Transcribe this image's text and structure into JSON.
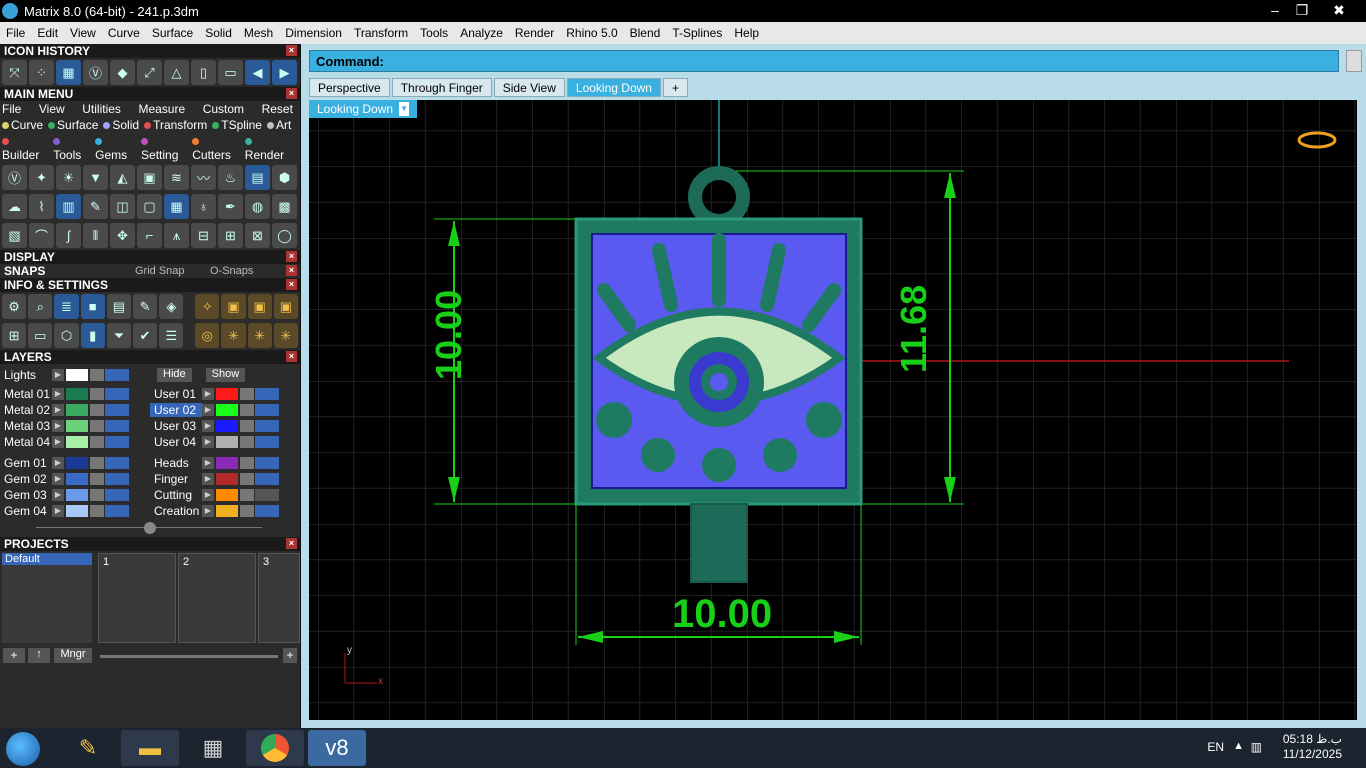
{
  "window": {
    "title": "Matrix 8.0 (64-bit) - 241.p.3dm",
    "controls": {
      "minimize": "‒",
      "maximize": "❐",
      "close": "✖"
    }
  },
  "menubar": [
    "File",
    "Edit",
    "View",
    "Curve",
    "Surface",
    "Solid",
    "Mesh",
    "Dimension",
    "Transform",
    "Tools",
    "Analyze",
    "Render",
    "Rhino 5.0",
    "Blend",
    "T-Splines",
    "Help"
  ],
  "panels": {
    "icon_history": "ICON HISTORY",
    "main_menu": "MAIN MENU",
    "main_menu_row1": [
      "File",
      "View",
      "Utilities",
      "Measure",
      "Custom",
      "Reset"
    ],
    "main_menu_row2": [
      {
        "label": "Curve",
        "color": "#d8d860"
      },
      {
        "label": "Surface",
        "color": "#3ab060"
      },
      {
        "label": "Solid",
        "color": "#a0a0ff"
      },
      {
        "label": "Transform",
        "color": "#e05050"
      },
      {
        "label": "TSpline",
        "color": "#3ab060"
      },
      {
        "label": "Art",
        "color": "#c0c0c0"
      }
    ],
    "main_menu_row3": [
      {
        "label": "Builder",
        "color": "#e05050"
      },
      {
        "label": "Tools",
        "color": "#8060d0"
      },
      {
        "label": "Gems",
        "color": "#3ab0e0"
      },
      {
        "label": "Setting",
        "color": "#c050c0"
      },
      {
        "label": "Cutters",
        "color": "#f08030"
      },
      {
        "label": "Render",
        "color": "#3ab0a0"
      }
    ],
    "display": "DISPLAY",
    "snaps": "SNAPS",
    "grid_snap": "Grid Snap",
    "osnaps": "O-Snaps",
    "info_settings": "INFO & SETTINGS",
    "layers": "LAYERS",
    "lights": "Lights",
    "hide": "Hide",
    "show": "Show",
    "projects": "PROJECTS",
    "project_default": "Default",
    "project_slots": [
      "1",
      "2",
      "3"
    ],
    "mngr": "Mngr"
  },
  "layers_left": [
    {
      "name": "Metal 01",
      "color": "#1a7a50"
    },
    {
      "name": "Metal 02",
      "color": "#3aaa60"
    },
    {
      "name": "Metal 03",
      "color": "#6ad07a"
    },
    {
      "name": "Metal 04",
      "color": "#a8f0a8"
    },
    {
      "name": "Gem 01",
      "color": "#1a3a98"
    },
    {
      "name": "Gem 02",
      "color": "#3a6ac8"
    },
    {
      "name": "Gem 03",
      "color": "#6a9ae8"
    },
    {
      "name": "Gem 04",
      "color": "#a8c8f8"
    }
  ],
  "layers_right": [
    {
      "name": "User 01",
      "color": "#ff1a1a"
    },
    {
      "name": "User 02",
      "color": "#1aff1a"
    },
    {
      "name": "User 03",
      "color": "#1a1aff"
    },
    {
      "name": "User 04",
      "color": "#b0b0b0"
    },
    {
      "name": "Heads",
      "color": "#8a2ab8"
    },
    {
      "name": "Finger",
      "color": "#b02a2a"
    },
    {
      "name": "Cutting",
      "color": "#ff8a00"
    },
    {
      "name": "Creation",
      "color": "#f0b020"
    }
  ],
  "command": {
    "label": "Command:"
  },
  "tabs": [
    "Perspective",
    "Through Finger",
    "Side View",
    "Looking Down"
  ],
  "active_tab": "Looking Down",
  "viewport_label": "Looking Down",
  "dimensions": {
    "height": "10.00",
    "total_height": "11.68",
    "width": "10.00"
  },
  "axis": {
    "x": "x",
    "y": "y"
  },
  "taskbar": {
    "lang": "EN",
    "time": "05:18 ب.ظ",
    "date": "11/12/2025"
  }
}
